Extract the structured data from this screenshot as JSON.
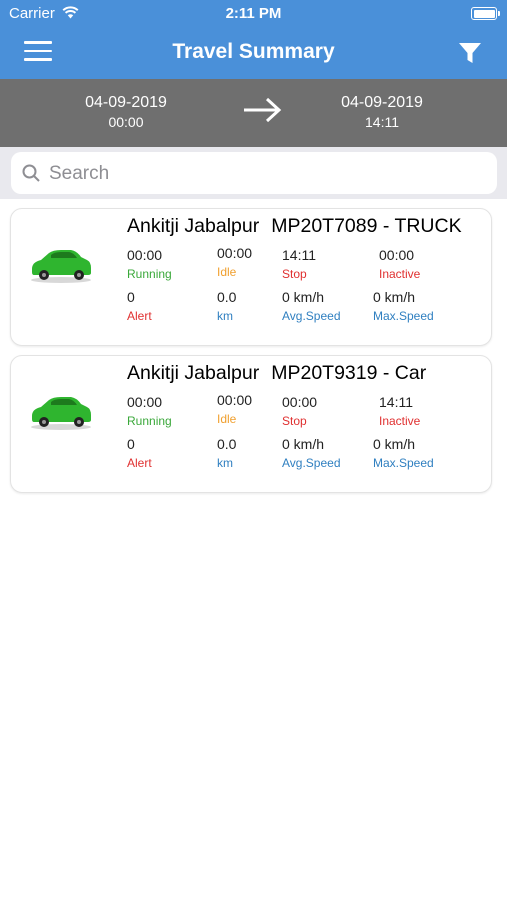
{
  "status_bar": {
    "carrier": "Carrier",
    "time": "2:11 PM"
  },
  "nav": {
    "title": "Travel Summary"
  },
  "date_range": {
    "from_date": "04-09-2019",
    "from_time": "00:00",
    "to_date": "04-09-2019",
    "to_time": "14:11"
  },
  "search": {
    "placeholder": "Search",
    "value": ""
  },
  "colors": {
    "header": "#4a90d9",
    "datebar": "#6f6f6f",
    "running": "#3aa83a",
    "idle": "#f0a030",
    "stop": "#e03030",
    "info": "#2f7fc0",
    "car": "#2fb52f"
  },
  "vehicles": [
    {
      "name": "Ankitji Jabalpur",
      "vehicle": "MP20T7089 - TRUCK",
      "running": "00:00",
      "running_label": "Running",
      "idle": "00:00",
      "idle_label": "Idle",
      "stop": "14:11",
      "stop_label": "Stop",
      "inactive": "00:00",
      "inactive_label": "Inactive",
      "alert": "0",
      "alert_label": "Alert",
      "km": "0.0",
      "km_label": "km",
      "avg_speed": "0 km/h",
      "avg_speed_label": "Avg.Speed",
      "max_speed": "0 km/h",
      "max_speed_label": "Max.Speed"
    },
    {
      "name": "Ankitji Jabalpur",
      "vehicle": "MP20T9319 - Car",
      "running": "00:00",
      "running_label": "Running",
      "idle": "00:00",
      "idle_label": "Idle",
      "stop": "00:00",
      "stop_label": "Stop",
      "inactive": "14:11",
      "inactive_label": "Inactive",
      "alert": "0",
      "alert_label": "Alert",
      "km": "0.0",
      "km_label": "km",
      "avg_speed": "0 km/h",
      "avg_speed_label": "Avg.Speed",
      "max_speed": "0 km/h",
      "max_speed_label": "Max.Speed"
    }
  ]
}
